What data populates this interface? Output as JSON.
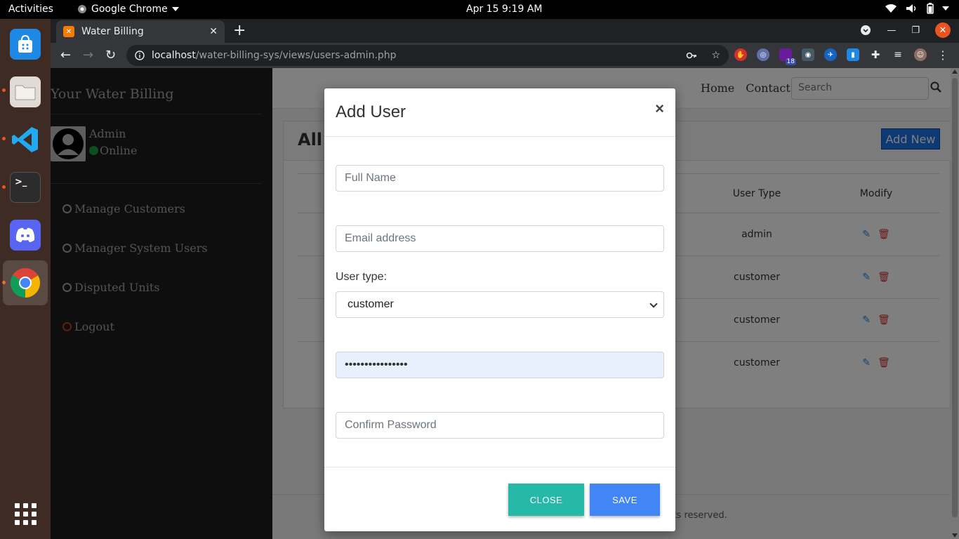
{
  "topbar": {
    "activities": "Activities",
    "app_name": "Google Chrome",
    "datetime": "Apr 15   9:19 AM"
  },
  "dock": {
    "items": [
      "software-store",
      "files",
      "vscode",
      "terminal",
      "discord",
      "chrome"
    ],
    "show_apps": "show-applications"
  },
  "chrome": {
    "tab_title": "Water Billing",
    "url_host": "localhost",
    "url_path": "/water-billing-sys/views/users-admin.php",
    "ext_badge": "18"
  },
  "sidebar": {
    "brand": "Your Water Billing",
    "user_name": "Admin",
    "user_status": "Online",
    "items": [
      {
        "label": "Manage Customers"
      },
      {
        "label": "Manager System Users"
      },
      {
        "label": "Disputed Units"
      },
      {
        "label": "Logout"
      }
    ]
  },
  "main": {
    "nav": {
      "home": "Home",
      "contact": "Contact",
      "search_placeholder": "Search"
    },
    "card_title": "All S",
    "add_new": "Add New",
    "columns": {
      "user_type": "User Type",
      "modify": "Modify"
    },
    "rows": [
      {
        "user_type": "admin"
      },
      {
        "user_type": "customer"
      },
      {
        "user_type": "customer"
      },
      {
        "user_type": "customer"
      }
    ],
    "footer": "rights reserved."
  },
  "modal": {
    "title": "Add User",
    "close_x": "×",
    "fullname_placeholder": "Full Name",
    "email_placeholder": "Email address",
    "usertype_label": "User type:",
    "usertype_value": "customer",
    "password_value": "••••••••••••••••",
    "confirm_placeholder": "Confirm Password",
    "close_label": "CLOSE",
    "save_label": "SAVE"
  },
  "colors": {
    "accent_close": "#26b9a8",
    "accent_save": "#4285f4",
    "online": "#1b9e3e",
    "ubuntu_orange": "#e95420"
  }
}
